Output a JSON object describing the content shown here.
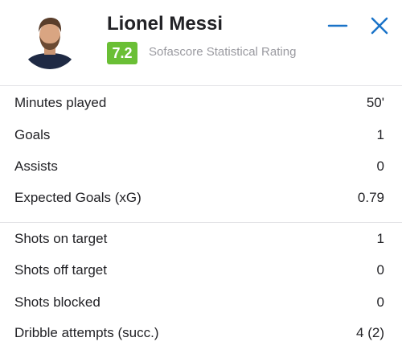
{
  "player": {
    "name": "Lionel Messi",
    "rating": "7.2",
    "rating_label": "Sofascore Statistical Rating"
  },
  "controls": {
    "minimize_icon": "minus-icon",
    "close_icon": "close-icon"
  },
  "colors": {
    "rating_badge": "#6abf35",
    "control_icons": "#1a73c8"
  },
  "stats_general": [
    {
      "label": "Minutes played",
      "value": "50'"
    },
    {
      "label": "Goals",
      "value": "1"
    },
    {
      "label": "Assists",
      "value": "0"
    },
    {
      "label": "Expected Goals (xG)",
      "value": "0.79"
    }
  ],
  "stats_attack": [
    {
      "label": "Shots on target",
      "value": "1"
    },
    {
      "label": "Shots off target",
      "value": "0"
    },
    {
      "label": "Shots blocked",
      "value": "0"
    },
    {
      "label": "Dribble attempts (succ.)",
      "value": "4 (2)"
    }
  ]
}
